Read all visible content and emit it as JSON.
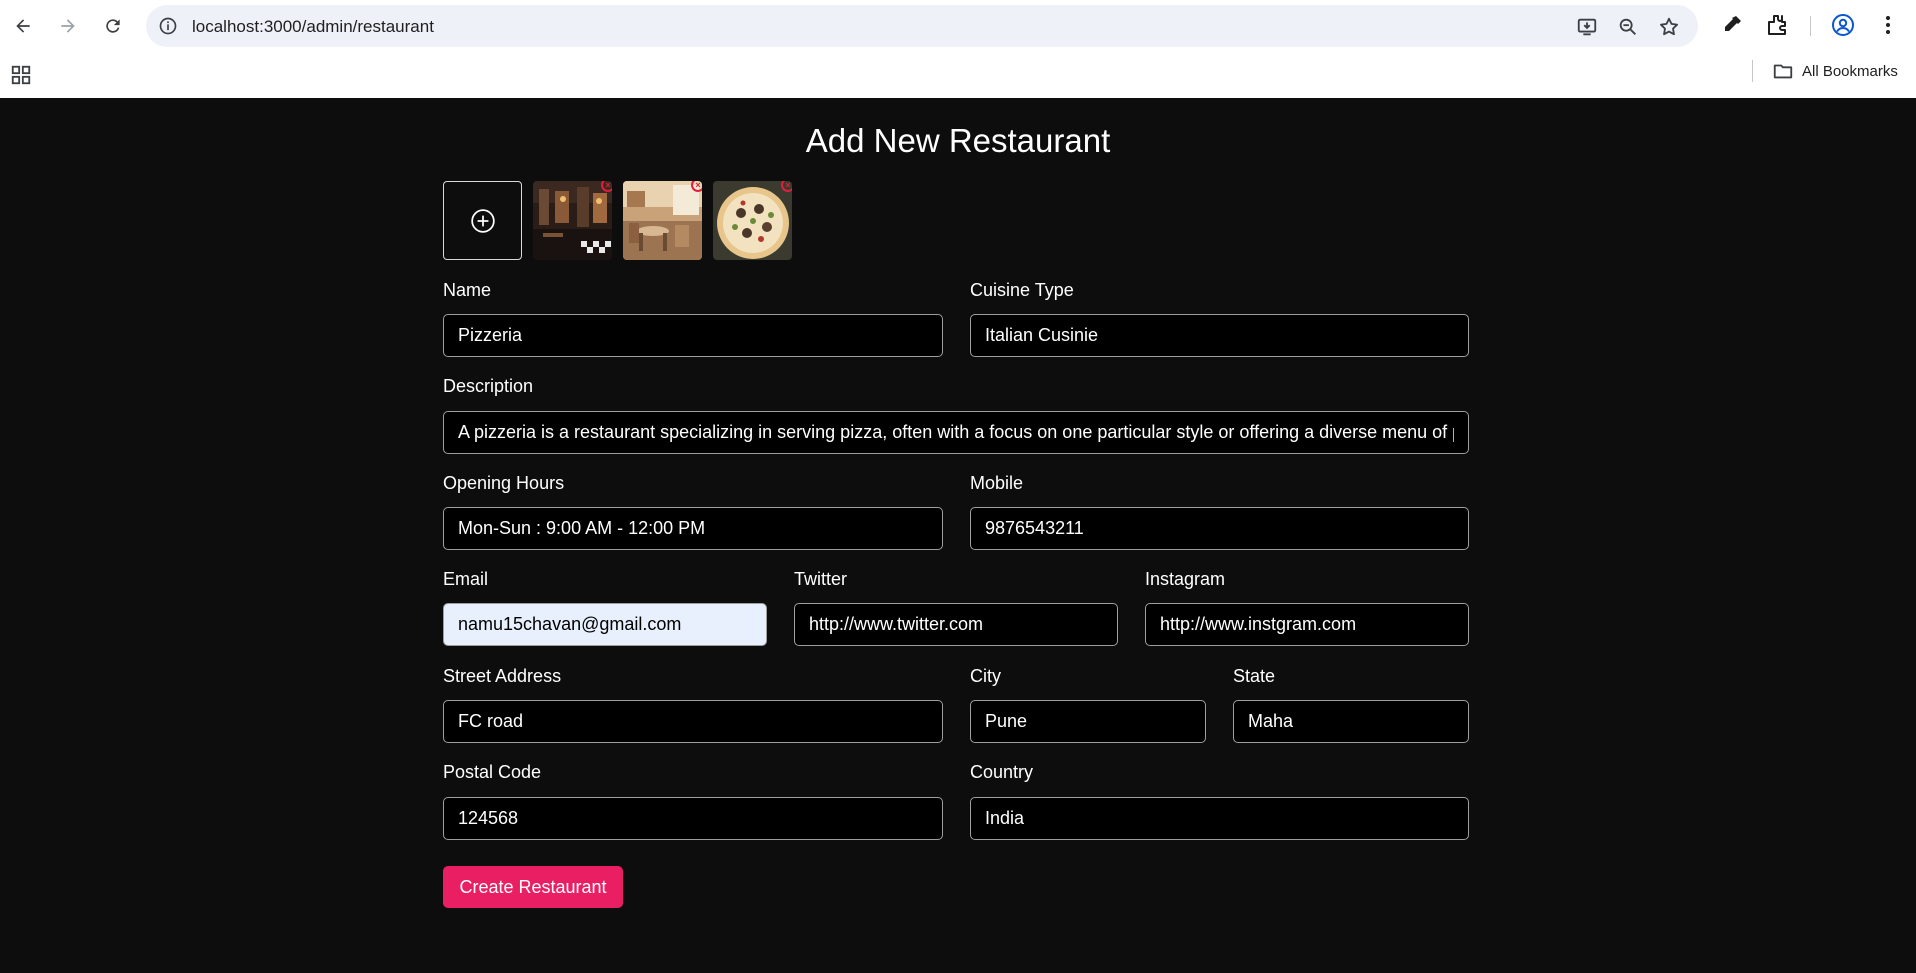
{
  "browser": {
    "url": "localhost:3000/admin/restaurant",
    "bookmarks_label": "All Bookmarks"
  },
  "page": {
    "title": "Add New Restaurant",
    "images": [
      {
        "alt": "restaurant interior dark"
      },
      {
        "alt": "restaurant interior bright"
      },
      {
        "alt": "pizza"
      }
    ],
    "remove_symbol": "×"
  },
  "form": {
    "name": {
      "label": "Name",
      "value": "Pizzeria"
    },
    "cuisine": {
      "label": "Cuisine Type",
      "value": "Italian Cusinie"
    },
    "description": {
      "label": "Description",
      "value": "A pizzeria is a restaurant specializing in serving pizza, often with a focus on one particular style or offering a diverse menu of pizzas."
    },
    "opening_hours": {
      "label": "Opening Hours",
      "value": "Mon-Sun : 9:00 AM - 12:00 PM"
    },
    "mobile": {
      "label": "Mobile",
      "value": "9876543211"
    },
    "email": {
      "label": "Email",
      "value": "namu15chavan@gmail.com"
    },
    "twitter": {
      "label": "Twitter",
      "value": "http://www.twitter.com"
    },
    "instagram": {
      "label": "Instagram",
      "value": "http://www.instgram.com"
    },
    "street": {
      "label": "Street Address",
      "value": "FC road"
    },
    "city": {
      "label": "City",
      "value": "Pune"
    },
    "state": {
      "label": "State",
      "value": "Maha"
    },
    "postal": {
      "label": "Postal Code",
      "value": "124568"
    },
    "country": {
      "label": "Country",
      "value": "India"
    },
    "submit_label": "Create Restaurant"
  },
  "colors": {
    "background": "#0d0d0d",
    "accent": "#e91e63",
    "remove": "#e01f3d"
  }
}
